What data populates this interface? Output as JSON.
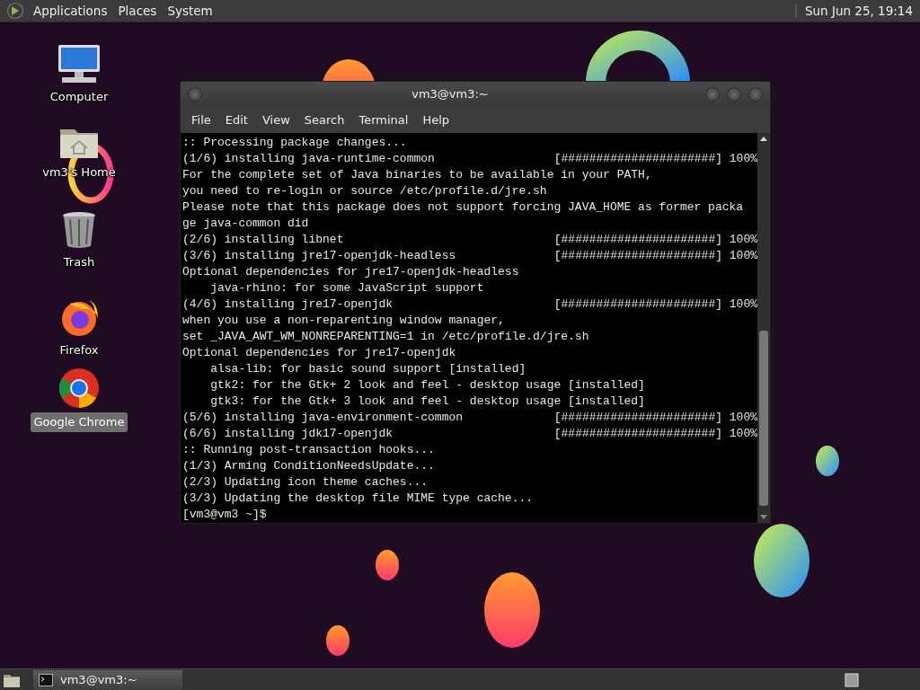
{
  "top_panel": {
    "menus": [
      "Applications",
      "Places",
      "System"
    ],
    "clock": "Sun Jun 25, 19:14"
  },
  "desktop_icons": [
    {
      "kind": "computer",
      "label": "Computer",
      "selected": false
    },
    {
      "kind": "folder",
      "label": "vm3's Home",
      "selected": false
    },
    {
      "kind": "trash",
      "label": "Trash",
      "selected": false
    },
    {
      "kind": "firefox",
      "label": "Firefox",
      "selected": false
    },
    {
      "kind": "chrome",
      "label": "Google Chrome",
      "selected": true
    }
  ],
  "window": {
    "title": "vm3@vm3:~",
    "menu": [
      "File",
      "Edit",
      "View",
      "Search",
      "Terminal",
      "Help"
    ],
    "lines": [
      {
        "text": ":: Processing package changes..."
      },
      {
        "text": "(1/6) installing java-runtime-common",
        "bar": "[######################] 100%"
      },
      {
        "text": "For the complete set of Java binaries to be available in your PATH,"
      },
      {
        "text": "you need to re-login or source /etc/profile.d/jre.sh"
      },
      {
        "text": "Please note that this package does not support forcing JAVA_HOME as former packa"
      },
      {
        "text": "ge java-common did"
      },
      {
        "text": "(2/6) installing libnet",
        "bar": "[######################] 100%"
      },
      {
        "text": "(3/6) installing jre17-openjdk-headless",
        "bar": "[######################] 100%"
      },
      {
        "text": "Optional dependencies for jre17-openjdk-headless"
      },
      {
        "text": "    java-rhino: for some JavaScript support"
      },
      {
        "text": "(4/6) installing jre17-openjdk",
        "bar": "[######################] 100%"
      },
      {
        "text": "when you use a non-reparenting window manager,"
      },
      {
        "text": "set _JAVA_AWT_WM_NONREPARENTING=1 in /etc/profile.d/jre.sh"
      },
      {
        "text": "Optional dependencies for jre17-openjdk"
      },
      {
        "text": "    alsa-lib: for basic sound support [installed]"
      },
      {
        "text": "    gtk2: for the Gtk+ 2 look and feel - desktop usage [installed]"
      },
      {
        "text": "    gtk3: for the Gtk+ 3 look and feel - desktop usage [installed]"
      },
      {
        "text": "(5/6) installing java-environment-common",
        "bar": "[######################] 100%"
      },
      {
        "text": "(6/6) installing jdk17-openjdk",
        "bar": "[######################] 100%"
      },
      {
        "text": ":: Running post-transaction hooks..."
      },
      {
        "text": "(1/3) Arming ConditionNeedsUpdate..."
      },
      {
        "text": "(2/3) Updating icon theme caches..."
      },
      {
        "text": "(3/3) Updating the desktop file MIME type cache..."
      },
      {
        "text": "[vm3@vm3 ~]$"
      }
    ]
  },
  "bottom_panel": {
    "tasks": [
      {
        "label": "vm3@vm3:~",
        "selected": true
      }
    ]
  }
}
